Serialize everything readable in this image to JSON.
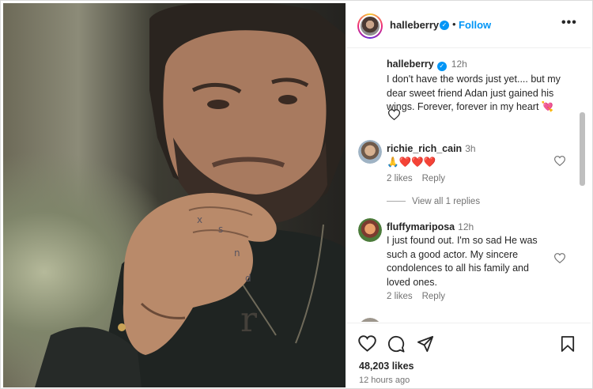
{
  "header": {
    "username": "halleberry",
    "separator": "•",
    "follow_label": "Follow",
    "more_label": "•••",
    "verified_mark": "✓"
  },
  "caption": {
    "username": "halleberry",
    "time": "12h",
    "text": "I don't have the words just yet.... but my dear sweet friend Adan just gained his wings. Forever, forever in my heart 💘",
    "verified_mark": "✓"
  },
  "comments": [
    {
      "username": "richie_rich_cain",
      "time": "3h",
      "text": "🙏❤️❤️❤️",
      "likes": "2 likes",
      "reply_label": "Reply",
      "view_replies": "View all 1 replies"
    },
    {
      "username": "fluffymariposa",
      "time": "12h",
      "text": "I just found out. I'm so sad He was such a good actor. My sincere condolences to all his family and loved ones.",
      "likes": "2 likes",
      "reply_label": "Reply"
    }
  ],
  "footer": {
    "likes": "48,203 likes",
    "posted": "12 hours ago"
  },
  "icons": {
    "like": "heart-icon",
    "comment": "comment-icon",
    "share": "share-icon",
    "save": "bookmark-icon",
    "more": "more-options-icon",
    "verified": "verified-badge-icon"
  },
  "colors": {
    "accent": "#0095f6",
    "text": "#262626",
    "secondary": "#737373",
    "border": "#dbdbdb"
  }
}
